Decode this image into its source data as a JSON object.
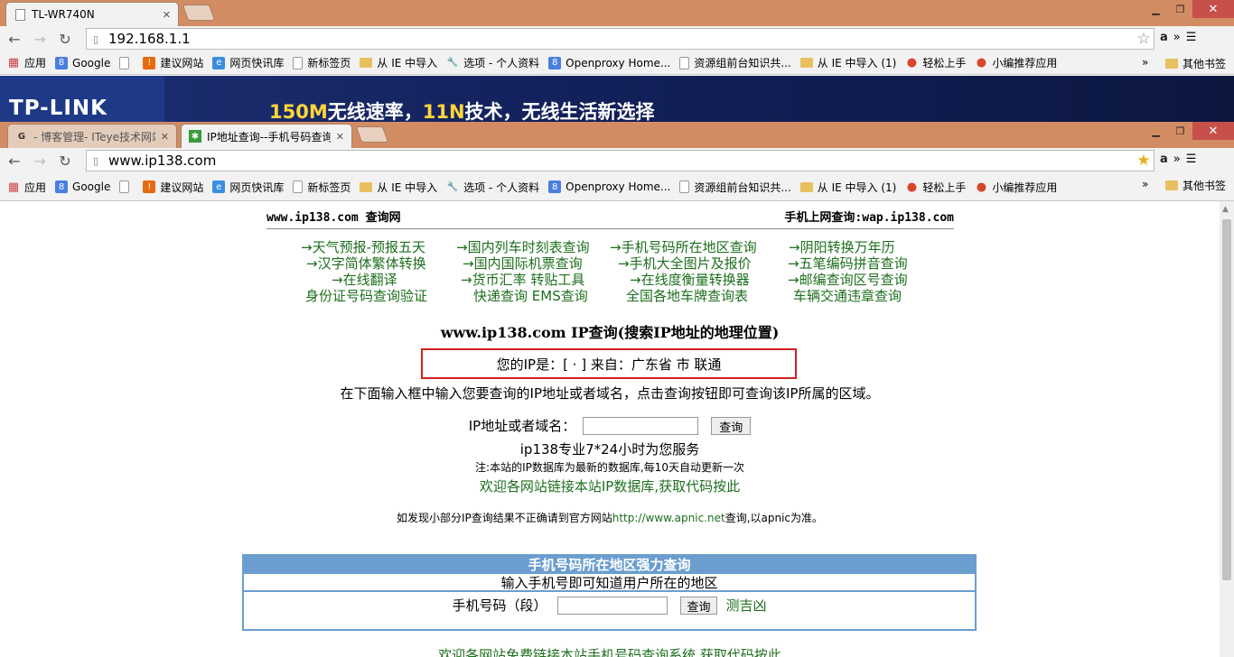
{
  "window1": {
    "tab_title": "TL-WR740N",
    "url": "192.168.1.1",
    "controls": {
      "minimize": "▁",
      "maximize": "❐",
      "close": "✕"
    }
  },
  "window2": {
    "tabs": [
      {
        "title": "- 博客管理- ITeye技术网站",
        "active": false
      },
      {
        "title": "IP地址查询--手机号码查询归属地",
        "active": true
      }
    ],
    "url": "www.ip138.com",
    "controls": {
      "minimize": "▁",
      "maximize": "❐",
      "close": "✕"
    }
  },
  "bookmarks": [
    {
      "label": "应用",
      "icon": "apps-icon"
    },
    {
      "label": "Google",
      "icon": "google-icon"
    },
    {
      "label": "",
      "icon": "page-icon"
    },
    {
      "label": "建议网站",
      "icon": "suggest-icon"
    },
    {
      "label": "网页快讯库",
      "icon": "ie-icon"
    },
    {
      "label": "新标签页",
      "icon": "page-icon"
    },
    {
      "label": "从 IE 中导入",
      "icon": "folder-icon"
    },
    {
      "label": "选项 - 个人资料",
      "icon": "wrench-icon"
    },
    {
      "label": "Openproxy Home...",
      "icon": "google-icon"
    },
    {
      "label": "资源组前台知识共...",
      "icon": "page-icon"
    },
    {
      "label": "从 IE 中导入 (1)",
      "icon": "folder-icon"
    },
    {
      "label": "轻松上手",
      "icon": "chrome-icon"
    },
    {
      "label": "小编推荐应用",
      "icon": "chrome-icon"
    }
  ],
  "bookmarks_more": "»",
  "bookmarks_other": "其他书签",
  "toolbar_more": "»",
  "banner": {
    "logo": "TP-LINK",
    "slogan_a": "150M",
    "slogan_b": "无线速率，",
    "slogan_c": "11N",
    "slogan_d": "技术，无线生活新选择"
  },
  "page": {
    "header_left": "www.ip138.com 查询网",
    "header_right": "手机上网查询:wap.ip138.com",
    "links": [
      [
        "→天气预报-预报五天",
        "→国内列车时刻表查询",
        "→手机号码所在地区查询",
        "→阴阳转换万年历"
      ],
      [
        "→汉字简体繁体转换",
        "→国内国际机票查询",
        "→手机大全图片及报价",
        "→五笔编码拼音查询"
      ],
      [
        "→在线翻译",
        "→货币汇率 转贴工具",
        "→在线度衡量转换器",
        "→邮编查询区号查询"
      ],
      [
        "身份证号码查询验证",
        "快递查询 EMS查询",
        "全国各地车牌查询表",
        "车辆交通违章查询"
      ]
    ],
    "title": "www.ip138.com IP查询(搜索IP地址的地理位置)",
    "ip_line": "您的IP是：[        ·        ] 来自：广东省    市 联通",
    "instruction": "在下面输入框中输入您要查询的IP地址或者域名，点击查询按钮即可查询该IP所属的区域。",
    "form_label": "IP地址或者域名：",
    "form_button": "查询",
    "service": "ip138专业7*24小时为您服务",
    "note": "注:本站的IP数据库为最新的数据库,每10天自动更新一次",
    "link_db": "欢迎各网站链接本站IP数据库,获取代码按此",
    "apnic_a": "如发现小部分IP查询结果不正确请到官方网站",
    "apnic_link": "http://www.apnic.net",
    "apnic_b": "查询,以apnic为准。",
    "mobile": {
      "title": "手机号码所在地区强力查询",
      "subtitle": "输入手机号即可知道用户所在的地区",
      "label": "手机号码（段）",
      "button": "查询",
      "extra": "测吉凶"
    },
    "footer": "欢迎各网站免费链接本站手机号码查询系统,获取代码按此"
  }
}
